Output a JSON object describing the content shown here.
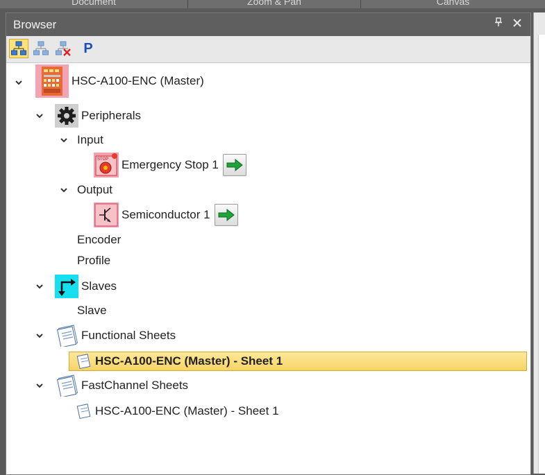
{
  "top_tabs": [
    "Document",
    "Zoom & Pan",
    "Canvas"
  ],
  "panel": {
    "title": "Browser",
    "pin_glyph": "📌",
    "close_glyph": "✕"
  },
  "toolbar": {
    "buttons": [
      {
        "name": "network-tree-icon",
        "active": true
      },
      {
        "name": "network-disabled-icon",
        "active": false
      },
      {
        "name": "network-remove-icon",
        "active": false
      },
      {
        "name": "p-icon",
        "label": "P",
        "active": false
      }
    ]
  },
  "tree": {
    "root": {
      "label": "HSC-A100-ENC (Master)"
    },
    "peripherals": {
      "label": "Peripherals"
    },
    "input": {
      "label": "Input"
    },
    "emergency_stop": {
      "label": "Emergency Stop 1"
    },
    "output": {
      "label": "Output"
    },
    "semiconductor": {
      "label": "Semiconductor 1"
    },
    "encoder": {
      "label": "Encoder"
    },
    "profile": {
      "label": "Profile"
    },
    "slaves": {
      "label": "Slaves"
    },
    "slave": {
      "label": "Slave"
    },
    "functional_sheets": {
      "label": "Functional Sheets"
    },
    "functional_sheet_1": {
      "label": "HSC-A100-ENC (Master) - Sheet 1",
      "selected": true
    },
    "fastchannel_sheets": {
      "label": "FastChannel Sheets"
    },
    "fastchannel_sheet_1": {
      "label": "HSC-A100-ENC (Master) - Sheet 1"
    }
  },
  "colors": {
    "header_bg": "#5f5f5f",
    "selection": "#fbe27a",
    "arrow_green": "#1fa33a"
  }
}
